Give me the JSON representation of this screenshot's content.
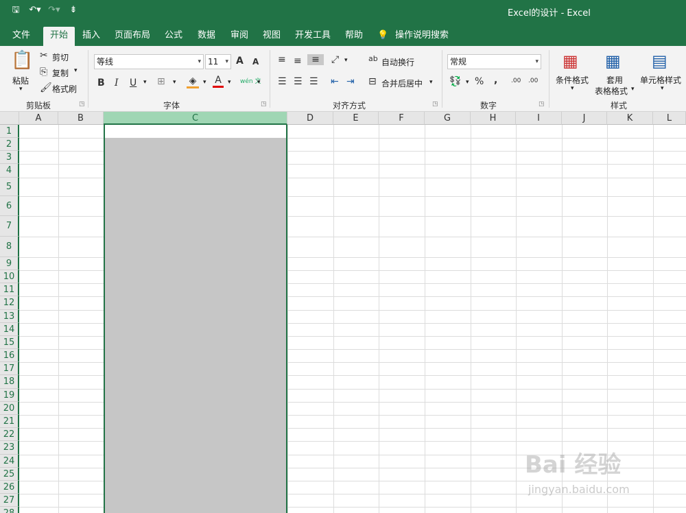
{
  "window": {
    "title": "Excel的设计  -  Excel"
  },
  "qat": {
    "save_icon": "save-icon",
    "undo_icon": "undo-icon",
    "redo_icon": "redo-icon",
    "customize_icon": "customize-qat-icon"
  },
  "tabs": [
    "文件",
    "开始",
    "插入",
    "页面布局",
    "公式",
    "数据",
    "审阅",
    "视图",
    "开发工具",
    "帮助"
  ],
  "tell_me": "操作说明搜索",
  "ribbon": {
    "clipboard": {
      "paste": "粘贴",
      "cut": "剪切",
      "copy": "复制",
      "format_painter": "格式刷",
      "group": "剪贴板"
    },
    "font": {
      "name": "等线",
      "size": "11",
      "group": "字体",
      "bold": "B",
      "italic": "I",
      "underline": "U",
      "increase": "A",
      "decrease": "A",
      "phonetic": "wén 文"
    },
    "alignment": {
      "wrap": "自动换行",
      "merge": "合并后居中",
      "group": "对齐方式"
    },
    "number": {
      "format": "常规",
      "percent": "%",
      "comma": ",",
      "inc_dec": ".00",
      "dec_dec": ".00",
      "group": "数字"
    },
    "styles": {
      "conditional": "条件格式",
      "table_line1": "套用",
      "table_line2": "表格格式",
      "cell_styles": "单元格样式",
      "group": "样式"
    }
  },
  "columns": [
    "A",
    "B",
    "C",
    "D",
    "E",
    "F",
    "G",
    "H",
    "I",
    "J",
    "K",
    "L"
  ],
  "rows": [
    "1",
    "2",
    "3",
    "4",
    "5",
    "6",
    "7",
    "8",
    "9",
    "10",
    "11",
    "12",
    "13",
    "14",
    "15",
    "16",
    "17",
    "18",
    "19",
    "20",
    "21",
    "22",
    "23",
    "24",
    "25",
    "26",
    "27",
    "28"
  ],
  "selected_column": "C",
  "watermark": {
    "main": "Bai 经验",
    "sub": "jingyan.baidu.com"
  },
  "colors": {
    "accent": "#217346",
    "selection": "#c6c6c6",
    "selected_header": "#a0d6b4"
  }
}
